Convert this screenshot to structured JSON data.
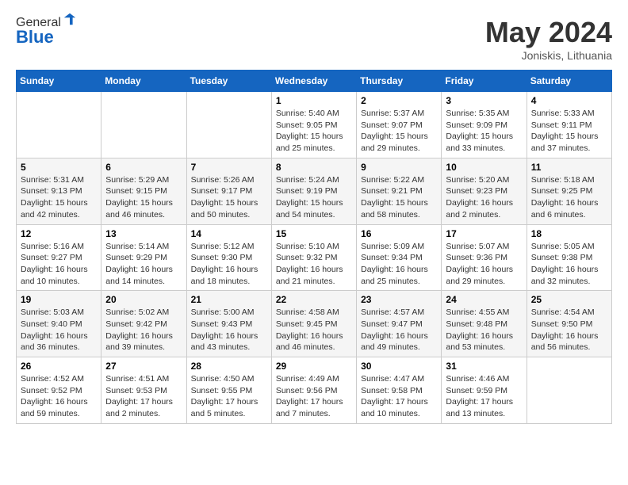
{
  "header": {
    "logo_general": "General",
    "logo_blue": "Blue",
    "month": "May 2024",
    "location": "Joniskis, Lithuania"
  },
  "weekdays": [
    "Sunday",
    "Monday",
    "Tuesday",
    "Wednesday",
    "Thursday",
    "Friday",
    "Saturday"
  ],
  "weeks": [
    [
      {
        "day": "",
        "info": ""
      },
      {
        "day": "",
        "info": ""
      },
      {
        "day": "",
        "info": ""
      },
      {
        "day": "1",
        "info": "Sunrise: 5:40 AM\nSunset: 9:05 PM\nDaylight: 15 hours\nand 25 minutes."
      },
      {
        "day": "2",
        "info": "Sunrise: 5:37 AM\nSunset: 9:07 PM\nDaylight: 15 hours\nand 29 minutes."
      },
      {
        "day": "3",
        "info": "Sunrise: 5:35 AM\nSunset: 9:09 PM\nDaylight: 15 hours\nand 33 minutes."
      },
      {
        "day": "4",
        "info": "Sunrise: 5:33 AM\nSunset: 9:11 PM\nDaylight: 15 hours\nand 37 minutes."
      }
    ],
    [
      {
        "day": "5",
        "info": "Sunrise: 5:31 AM\nSunset: 9:13 PM\nDaylight: 15 hours\nand 42 minutes."
      },
      {
        "day": "6",
        "info": "Sunrise: 5:29 AM\nSunset: 9:15 PM\nDaylight: 15 hours\nand 46 minutes."
      },
      {
        "day": "7",
        "info": "Sunrise: 5:26 AM\nSunset: 9:17 PM\nDaylight: 15 hours\nand 50 minutes."
      },
      {
        "day": "8",
        "info": "Sunrise: 5:24 AM\nSunset: 9:19 PM\nDaylight: 15 hours\nand 54 minutes."
      },
      {
        "day": "9",
        "info": "Sunrise: 5:22 AM\nSunset: 9:21 PM\nDaylight: 15 hours\nand 58 minutes."
      },
      {
        "day": "10",
        "info": "Sunrise: 5:20 AM\nSunset: 9:23 PM\nDaylight: 16 hours\nand 2 minutes."
      },
      {
        "day": "11",
        "info": "Sunrise: 5:18 AM\nSunset: 9:25 PM\nDaylight: 16 hours\nand 6 minutes."
      }
    ],
    [
      {
        "day": "12",
        "info": "Sunrise: 5:16 AM\nSunset: 9:27 PM\nDaylight: 16 hours\nand 10 minutes."
      },
      {
        "day": "13",
        "info": "Sunrise: 5:14 AM\nSunset: 9:29 PM\nDaylight: 16 hours\nand 14 minutes."
      },
      {
        "day": "14",
        "info": "Sunrise: 5:12 AM\nSunset: 9:30 PM\nDaylight: 16 hours\nand 18 minutes."
      },
      {
        "day": "15",
        "info": "Sunrise: 5:10 AM\nSunset: 9:32 PM\nDaylight: 16 hours\nand 21 minutes."
      },
      {
        "day": "16",
        "info": "Sunrise: 5:09 AM\nSunset: 9:34 PM\nDaylight: 16 hours\nand 25 minutes."
      },
      {
        "day": "17",
        "info": "Sunrise: 5:07 AM\nSunset: 9:36 PM\nDaylight: 16 hours\nand 29 minutes."
      },
      {
        "day": "18",
        "info": "Sunrise: 5:05 AM\nSunset: 9:38 PM\nDaylight: 16 hours\nand 32 minutes."
      }
    ],
    [
      {
        "day": "19",
        "info": "Sunrise: 5:03 AM\nSunset: 9:40 PM\nDaylight: 16 hours\nand 36 minutes."
      },
      {
        "day": "20",
        "info": "Sunrise: 5:02 AM\nSunset: 9:42 PM\nDaylight: 16 hours\nand 39 minutes."
      },
      {
        "day": "21",
        "info": "Sunrise: 5:00 AM\nSunset: 9:43 PM\nDaylight: 16 hours\nand 43 minutes."
      },
      {
        "day": "22",
        "info": "Sunrise: 4:58 AM\nSunset: 9:45 PM\nDaylight: 16 hours\nand 46 minutes."
      },
      {
        "day": "23",
        "info": "Sunrise: 4:57 AM\nSunset: 9:47 PM\nDaylight: 16 hours\nand 49 minutes."
      },
      {
        "day": "24",
        "info": "Sunrise: 4:55 AM\nSunset: 9:48 PM\nDaylight: 16 hours\nand 53 minutes."
      },
      {
        "day": "25",
        "info": "Sunrise: 4:54 AM\nSunset: 9:50 PM\nDaylight: 16 hours\nand 56 minutes."
      }
    ],
    [
      {
        "day": "26",
        "info": "Sunrise: 4:52 AM\nSunset: 9:52 PM\nDaylight: 16 hours\nand 59 minutes."
      },
      {
        "day": "27",
        "info": "Sunrise: 4:51 AM\nSunset: 9:53 PM\nDaylight: 17 hours\nand 2 minutes."
      },
      {
        "day": "28",
        "info": "Sunrise: 4:50 AM\nSunset: 9:55 PM\nDaylight: 17 hours\nand 5 minutes."
      },
      {
        "day": "29",
        "info": "Sunrise: 4:49 AM\nSunset: 9:56 PM\nDaylight: 17 hours\nand 7 minutes."
      },
      {
        "day": "30",
        "info": "Sunrise: 4:47 AM\nSunset: 9:58 PM\nDaylight: 17 hours\nand 10 minutes."
      },
      {
        "day": "31",
        "info": "Sunrise: 4:46 AM\nSunset: 9:59 PM\nDaylight: 17 hours\nand 13 minutes."
      },
      {
        "day": "",
        "info": ""
      }
    ]
  ]
}
